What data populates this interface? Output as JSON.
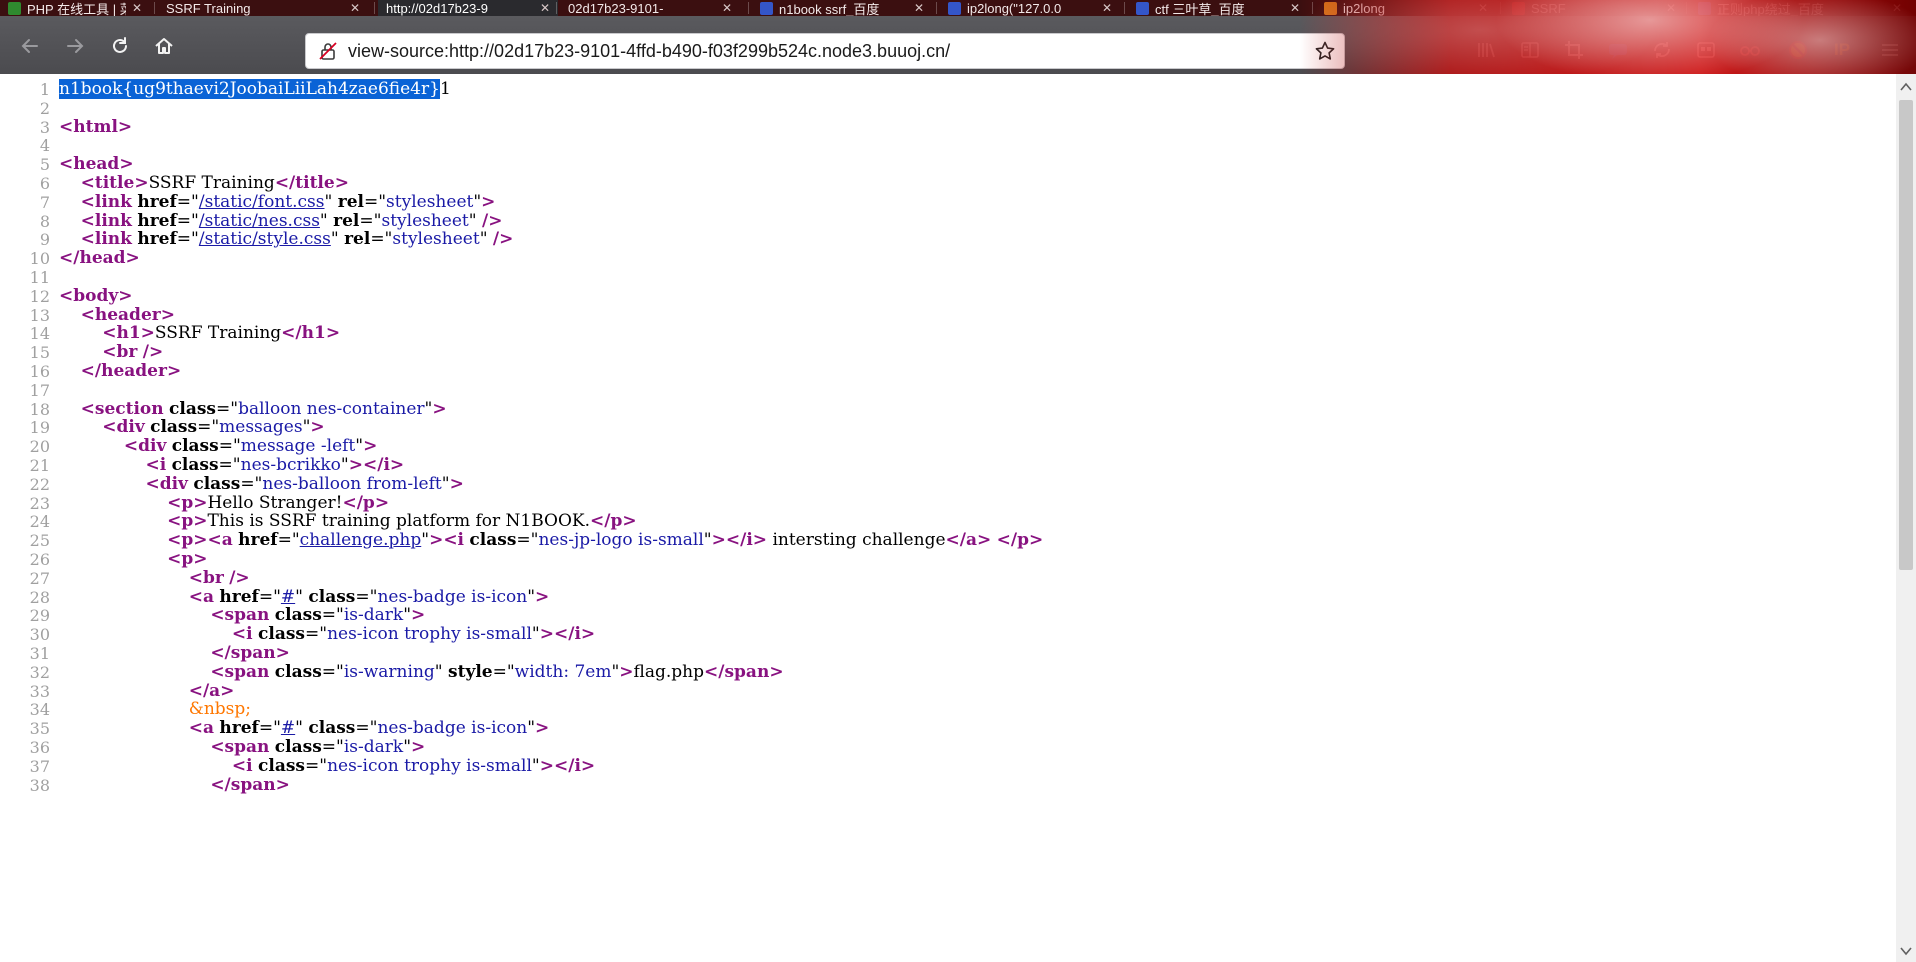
{
  "tabs": [
    {
      "label": "PHP 在线工具 | 菜",
      "favicon_color": "#2f8a2f",
      "active": false
    },
    {
      "label": "SSRF Training",
      "favicon_color": "",
      "active": false
    },
    {
      "label": "http://02d17b23-9",
      "favicon_color": "",
      "active": true
    },
    {
      "label": "02d17b23-9101-",
      "favicon_color": "",
      "active": false
    },
    {
      "label": "n1book ssrf_百度",
      "favicon_color": "#3456c9",
      "active": false
    },
    {
      "label": "ip2long(\"127.0.0",
      "favicon_color": "#3456c9",
      "active": false
    },
    {
      "label": "ctf 三叶草_百度",
      "favicon_color": "#3456c9",
      "active": false
    },
    {
      "label": "ip2long",
      "favicon_color": "#d97a1a",
      "active": false
    },
    {
      "label": "SSRF",
      "favicon_color": "#cc1a1a",
      "active": false
    },
    {
      "label": "正则php绕过_百度",
      "favicon_color": "#3456c9",
      "active": false
    }
  ],
  "navbar": {
    "url": "view-source:http://02d17b23-9101-4ffd-b490-f03f299b524c.node3.buuoj.cn/",
    "back_icon": "arrow-left-icon",
    "forward_icon": "arrow-right-icon",
    "reload_icon": "reload-icon",
    "home_icon": "home-icon",
    "bookmark_icon": "star-icon"
  },
  "toolbar_icons": [
    "library-icon",
    "reader-icon",
    "screenshot-icon",
    "chat-icon",
    "sync-icon",
    "container-icon",
    "glasses-icon",
    "block-icon",
    "ip-icon",
    "menu-icon"
  ],
  "toolbar_ip_label": "IP",
  "source": {
    "selected_flag": "n1book{ug9thaevi2JoobaiLiiLah4zae6fie4r}",
    "after_flag": "1",
    "lines": [
      "",
      "<html>",
      "",
      "<head>",
      "    <title>SSRF Training</title>",
      "    <link href=\"/static/font.css\" rel=\"stylesheet\">",
      "    <link href=\"/static/nes.css\" rel=\"stylesheet\" />",
      "    <link href=\"/static/style.css\" rel=\"stylesheet\" />",
      "</head>",
      "",
      "<body>",
      "    <header>",
      "        <h1>SSRF Training</h1>",
      "        <br />",
      "    </header>",
      "",
      "    <section class=\"balloon nes-container\">",
      "        <div class=\"messages\">",
      "            <div class=\"message -left\">",
      "                <i class=\"nes-bcrikko\"></i>",
      "                <div class=\"nes-balloon from-left\">",
      "                    <p>Hello Stranger!</p>",
      "                    <p>This is SSRF training platform for N1BOOK.</p>",
      "                    <p><a href=\"challenge.php\"><i class=\"nes-jp-logo is-small\"></i> intersting challenge</a> </p>",
      "                    <p>",
      "                        <br />",
      "                        <a href=\"#\" class=\"nes-badge is-icon\">",
      "                            <span class=\"is-dark\">",
      "                                <i class=\"nes-icon trophy is-small\"></i>",
      "                            </span>",
      "                            <span class=\"is-warning\" style=\"width: 7em\">flag.php</span>",
      "                        </a>",
      "                        &nbsp;",
      "                        <a href=\"#\" class=\"nes-badge is-icon\">",
      "                            <span class=\"is-dark\">",
      "                                <i class=\"nes-icon trophy is-small\"></i>",
      "                            </span>"
    ]
  }
}
